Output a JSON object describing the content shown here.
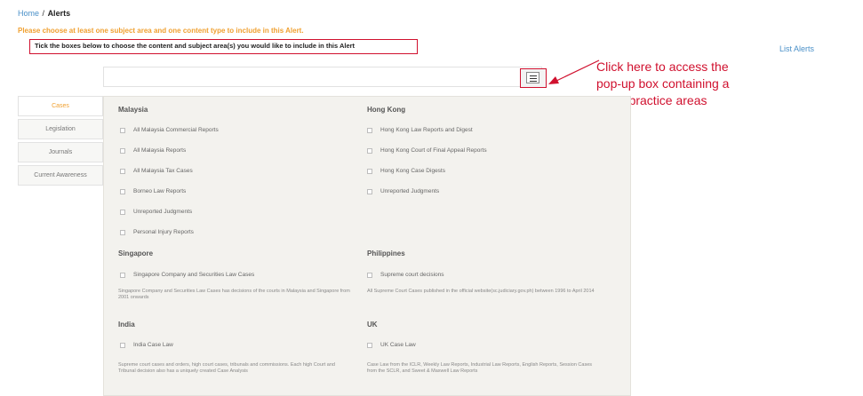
{
  "breadcrumb": {
    "home": "Home",
    "separator": "/",
    "current": "Alerts"
  },
  "warning_text": "Please choose at least one subject area and one content type to include in this Alert.",
  "instruction_text": "Tick the boxes below to choose the content and subject area(s) you would like to include in this Alert",
  "list_alerts_label": "List Alerts",
  "callout": {
    "line1": "Click here to access the",
    "line2": "pop-up box containing a",
    "line3": "list of practice areas",
    "color": "#d0102e"
  },
  "menu_button_icon": "hamburger-menu-icon",
  "tabs": [
    {
      "label": "Cases",
      "active": true
    },
    {
      "label": "Legislation",
      "active": false
    },
    {
      "label": "Journals",
      "active": false
    },
    {
      "label": "Current Awareness",
      "active": false
    }
  ],
  "regions": {
    "malaysia": {
      "title": "Malaysia",
      "items": [
        "All Malaysia Commercial Reports",
        "All Malaysia Reports",
        "All Malaysia Tax Cases",
        "Borneo Law Reports",
        "Unreported Judgments",
        "Personal Injury Reports"
      ]
    },
    "hong_kong": {
      "title": "Hong Kong",
      "items": [
        "Hong Kong Law Reports and Digest",
        "Hong Kong Court of Final Appeal Reports",
        "Hong Kong Case Digests",
        "Unreported Judgments"
      ]
    },
    "singapore": {
      "title": "Singapore",
      "items": [
        "Singapore Company and Securities Law Cases"
      ],
      "desc": "Singapore Company and Securities Law Cases has decisions of the courts in Malaysia and Singapore from 2001 onwards"
    },
    "philippines": {
      "title": "Philippines",
      "items": [
        "Supreme court decisions"
      ],
      "desc": "All Supreme Court Cases published in the official website(sc.judiciary.gov.ph) between 1996 to April 2014"
    },
    "india": {
      "title": "India",
      "items": [
        "India Case Law"
      ],
      "desc": "Supreme court cases and orders, high court cases, tribunals and commissions. Each high Court and Tribunal decision also has a uniquely created Case Analysis"
    },
    "uk": {
      "title": "UK",
      "items": [
        "UK Case Law"
      ],
      "desc": "Case Law from the ICLR, Weekly Law Reports, Industrial Law Reports, English Reports, Session Cases from the SCLR, and Sweet & Maxwell Law Reports"
    }
  },
  "colors": {
    "accent_orange": "#f0a030",
    "link_blue": "#4a90c8",
    "highlight_red": "#d0102e",
    "panel_bg": "#f3f2ee"
  }
}
